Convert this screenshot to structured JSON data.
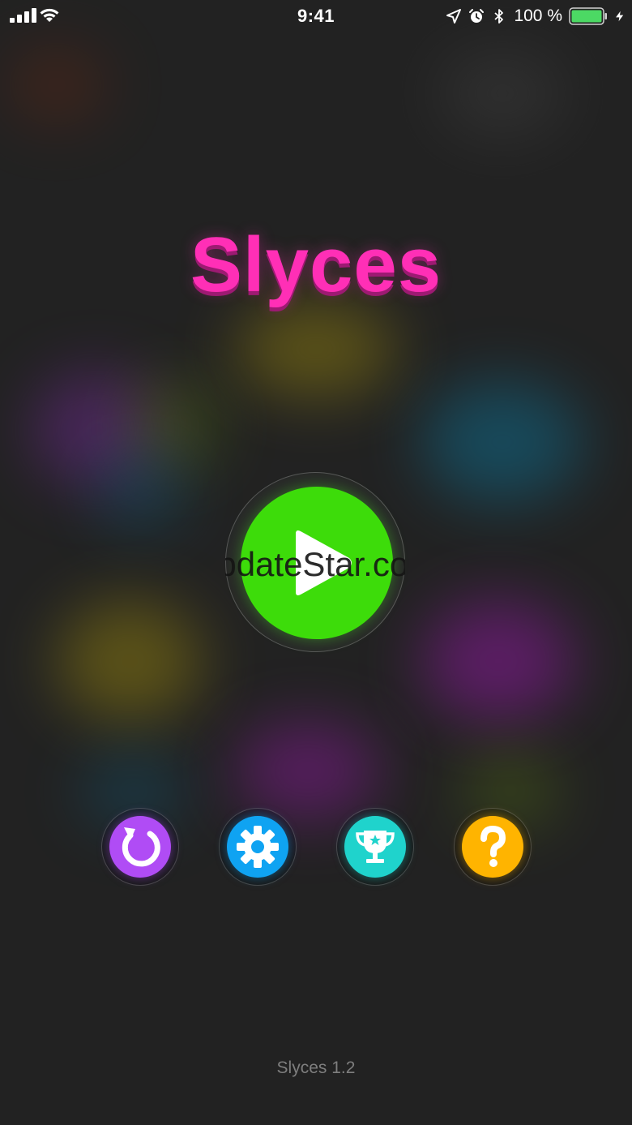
{
  "status_bar": {
    "time": "9:41",
    "battery_percent": "100 %",
    "battery_level": 1.0
  },
  "title": "Slyces",
  "watermark": "UpdateStar.com",
  "buttons": {
    "play": "play-icon",
    "restart": "restart-icon",
    "settings": "gear-icon",
    "leaderboard": "trophy-icon",
    "help": "help-icon"
  },
  "version": "Slyces 1.2",
  "colors": {
    "title": "#ff2fb6",
    "play": "#3ddc0a",
    "restart": "#b04cf5",
    "settings": "#0fa3f2",
    "leaderboard": "#1fd3cc",
    "help": "#ffb400",
    "battery": "#4cd964"
  }
}
